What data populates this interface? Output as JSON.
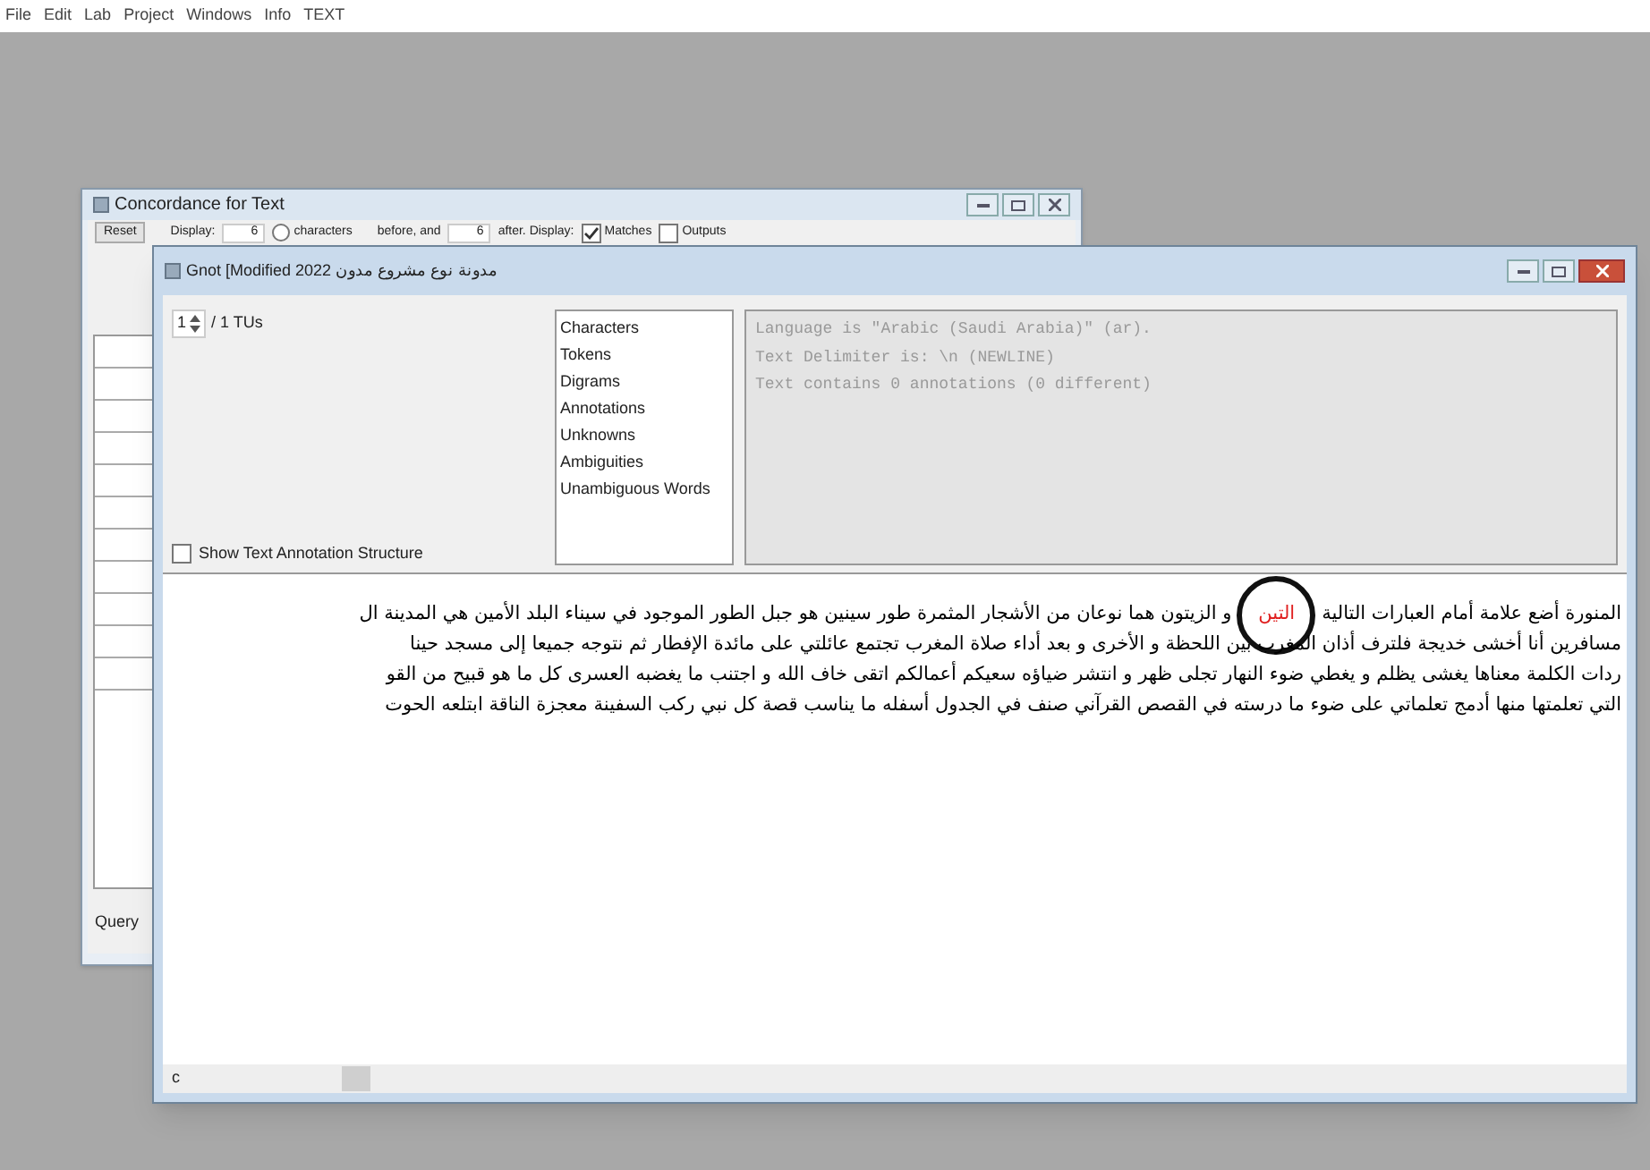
{
  "menu_bar": [
    "File",
    "Edit",
    "Lab",
    "Project",
    "Windows",
    "Info",
    "TEXT"
  ],
  "concordance_window": {
    "title": "Concordance for Text",
    "reset_button": "Reset",
    "display_label": "Display:",
    "before_value": "6",
    "characters_option": {
      "label": "characters",
      "selected": false
    },
    "before_label": "before, and",
    "after_value": "6",
    "after_label": "after. Display:",
    "options": [
      {
        "label": "Matches",
        "checked": true
      },
      {
        "label": "Outputs",
        "checked": false
      }
    ],
    "query_label": "Query"
  },
  "text_window": {
    "title": "Gnot [Modified 2022 مدونة نوع مشروع مدون",
    "unit_value": "1",
    "unit_total": "/ 1 TUs",
    "stats_list": [
      "Characters",
      "Tokens",
      "Digrams",
      "Annotations",
      "Unknowns",
      "Ambiguities",
      "Unambiguous Words"
    ],
    "info_lines": [
      "Language is \"Arabic (Saudi Arabia)\" (ar).",
      "Text Delimiter is: \\n (NEWLINE)",
      "Text contains 0 annotations (0 different)"
    ],
    "show_structure": {
      "label": "Show Text Annotation Structure",
      "checked": false
    },
    "text_lines": [
      {
        "segments": [
          {
            "text": "المنورة أضع علامة أمام العبارات التالية",
            "highlighted": false
          },
          {
            "text": "التين",
            "highlighted": true
          },
          {
            "text": "و الزيتون هما نوعان من الأشجار المثمرة طور سينين هو جبل الطور الموجود في سيناء البلد الأمين هي المدينة ال",
            "highlighted": false
          }
        ]
      },
      {
        "segments": [
          {
            "text": "مسافرين أنا أخشى خديجة فلترف أذان المغرب بين اللحظة و الأخرى و بعد أداء صلاة المغرب تجتمع عائلتي على مائدة الإفطار ثم نتوجه جميعا إلى مسجد حينا",
            "highlighted": false
          }
        ]
      },
      {
        "segments": [
          {
            "text": "ردات الكلمة معناها يغشى يظلم و يغطي ضوء النهار تجلى ظهر و انتشر ضياؤه سعيكم أعمالكم اتقى خاف الله و اجتنب ما يغضبه العسرى كل ما هو قبيح من القو",
            "highlighted": false
          }
        ]
      },
      {
        "segments": [
          {
            "text": "التي تعلمتها منها أدمج تعلماتي على ضوء ما درسته في القصص القرآني صنف في الجدول أسفله ما يناسب قصة كل نبي ركب السفينة معجزة الناقة ابتلعه الحوت",
            "highlighted": false
          }
        ]
      }
    ],
    "scroll_label": "c"
  }
}
